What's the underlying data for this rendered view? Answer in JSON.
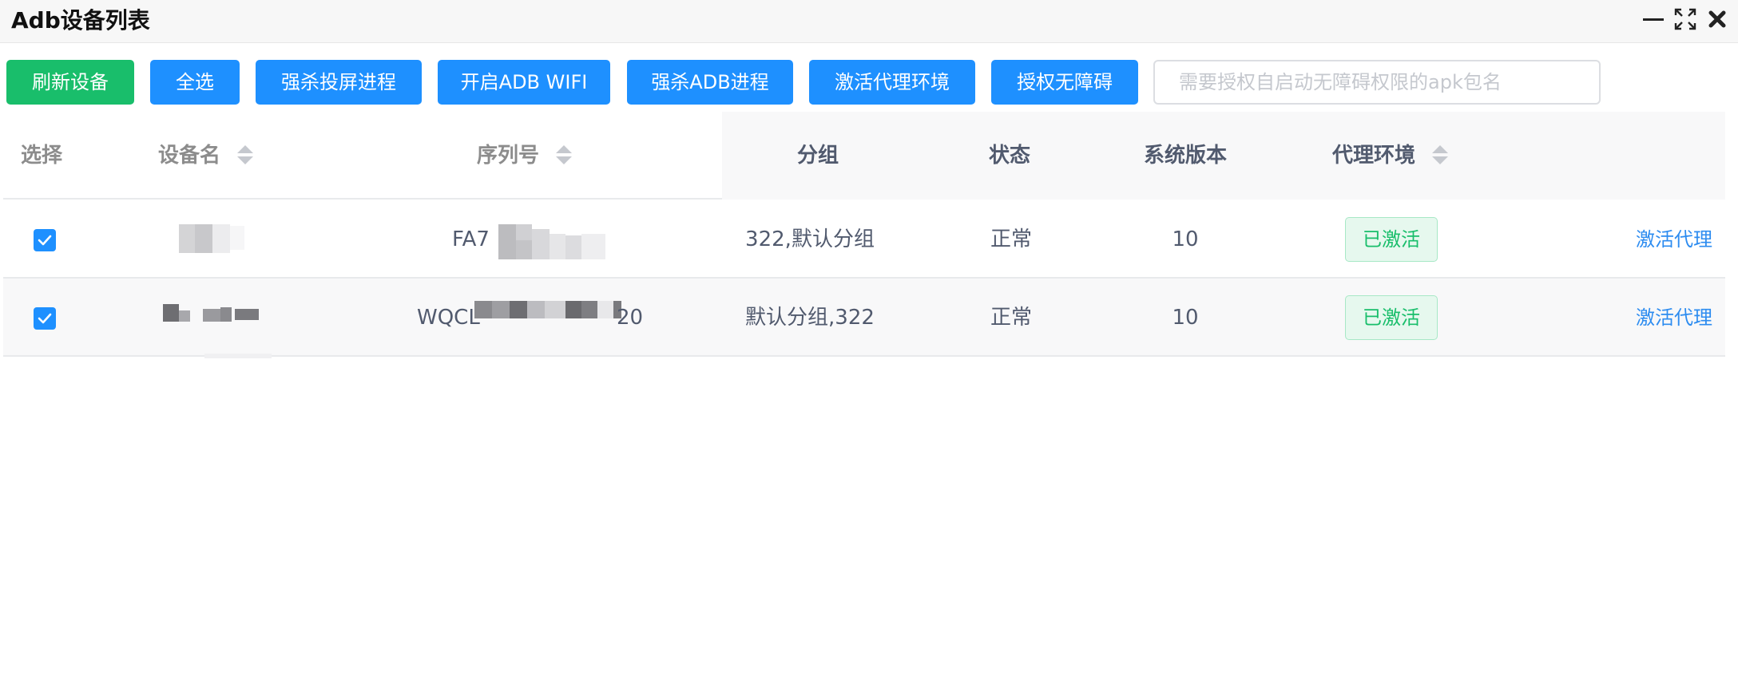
{
  "window": {
    "title": "Adb设备列表",
    "controls": {
      "minimize": "minimize-icon",
      "maximize": "fullscreen-icon",
      "close": "close-icon"
    }
  },
  "toolbar": {
    "buttons": [
      {
        "label": "刷新设备",
        "color": "#19be6b"
      },
      {
        "label": "全选",
        "color": "#1e90ff"
      },
      {
        "label": "强杀投屏进程",
        "color": "#1e90ff"
      },
      {
        "label": "开启ADB WIFI",
        "color": "#1e90ff"
      },
      {
        "label": "强杀ADB进程",
        "color": "#1e90ff"
      },
      {
        "label": "激活代理环境",
        "color": "#1e90ff"
      },
      {
        "label": "授权无障碍",
        "color": "#1e90ff"
      }
    ],
    "package_input": {
      "value": "",
      "placeholder": "需要授权自启动无障碍权限的apk包名"
    }
  },
  "table": {
    "columns": {
      "select": "选择",
      "device_name": "设备名",
      "serial": "序列号",
      "group": "分组",
      "status": "状态",
      "os_version": "系统版本",
      "proxy_env": "代理环境"
    },
    "rows": [
      {
        "checked": true,
        "device_name": "",
        "serial_visible_prefix": "FA7",
        "serial_visible_suffix": "",
        "group": "322,默认分组",
        "status": "正常",
        "os_version": "10",
        "proxy_env": "已激活",
        "action": "激活代理"
      },
      {
        "checked": true,
        "device_name": "",
        "serial_visible_prefix": "WQCL",
        "serial_visible_suffix": "20",
        "group": "默认分组,322",
        "status": "正常",
        "os_version": "10",
        "proxy_env": "已激活",
        "action": "激活代理"
      }
    ]
  },
  "colors": {
    "primary": "#1e90ff",
    "success": "#19be6b",
    "link": "#2d8cf0"
  }
}
